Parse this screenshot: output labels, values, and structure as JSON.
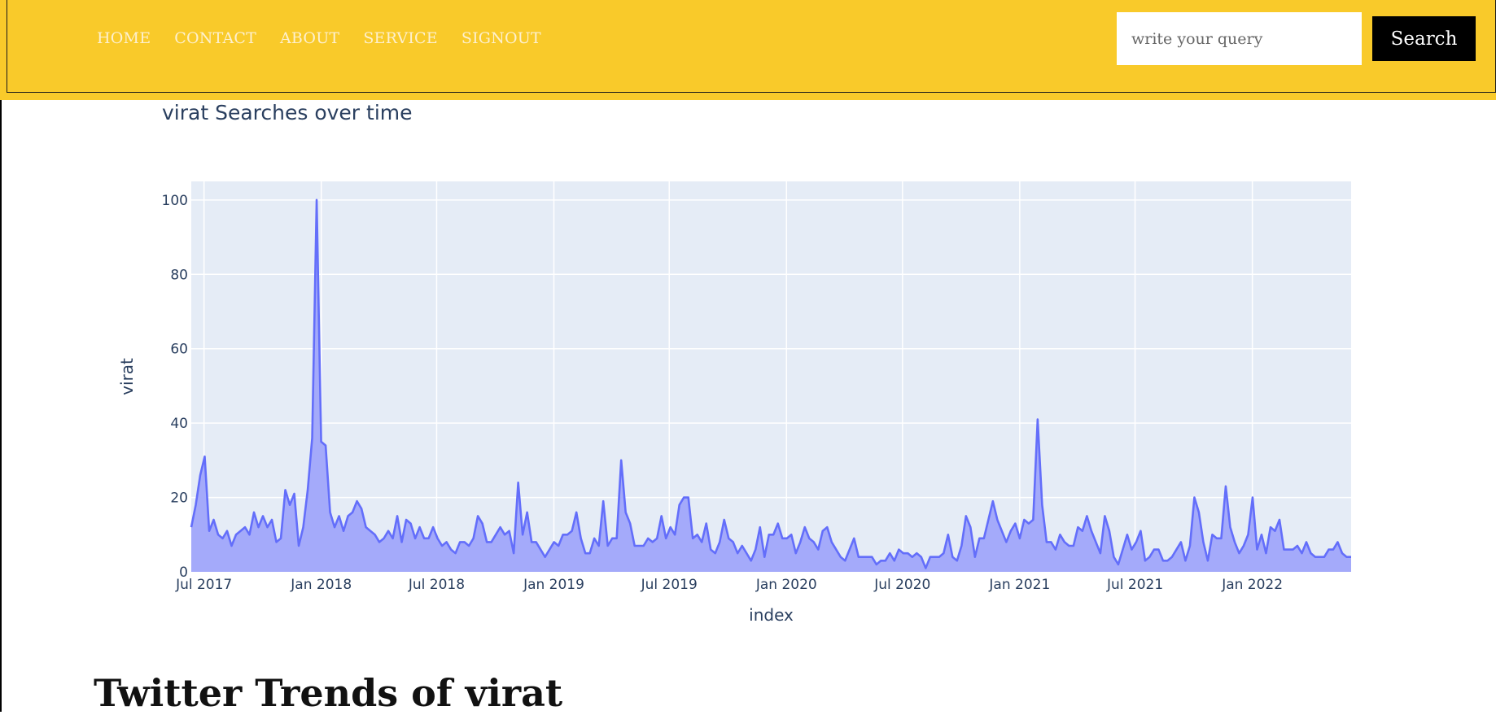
{
  "nav": {
    "links": [
      "HOME",
      "CONTACT",
      "ABOUT",
      "SERVICE",
      "SIGNOUT"
    ],
    "search_placeholder": "write your query",
    "search_button": "Search"
  },
  "colors": {
    "navbar": "#F9CA2A",
    "plot_bg": "#E5ECF6",
    "line": "#636EFA",
    "fill": "#A4AAFA"
  },
  "chart_title": "virat Searches over time",
  "chart_data": {
    "type": "area",
    "title": "virat Searches over time",
    "xlabel": "index",
    "ylabel": "virat",
    "x_start": "2017-06-11",
    "x_end": "2022-06-05",
    "x_ticks": [
      "Jul 2017",
      "Jan 2018",
      "Jul 2018",
      "Jan 2019",
      "Jul 2019",
      "Jan 2020",
      "Jul 2020",
      "Jan 2021",
      "Jul 2021",
      "Jan 2022"
    ],
    "y_ticks": [
      "0",
      "20",
      "40",
      "60",
      "80",
      "100"
    ],
    "ylim": [
      0,
      105
    ],
    "grid": true,
    "series": [
      {
        "name": "virat",
        "values": [
          12,
          18,
          26,
          31,
          11,
          14,
          10,
          9,
          11,
          7,
          10,
          11,
          12,
          10,
          16,
          12,
          15,
          12,
          14,
          8,
          9,
          22,
          18,
          21,
          7,
          12,
          22,
          36,
          100,
          35,
          34,
          16,
          12,
          15,
          11,
          15,
          16,
          19,
          17,
          12,
          11,
          10,
          8,
          9,
          11,
          9,
          15,
          8,
          14,
          13,
          9,
          12,
          9,
          9,
          12,
          9,
          7,
          8,
          6,
          5,
          8,
          8,
          7,
          9,
          15,
          13,
          8,
          8,
          10,
          12,
          10,
          11,
          5,
          24,
          10,
          16,
          8,
          8,
          6,
          4,
          6,
          8,
          7,
          10,
          10,
          11,
          16,
          9,
          5,
          5,
          9,
          7,
          19,
          7,
          9,
          9,
          30,
          16,
          13,
          7,
          7,
          7,
          9,
          8,
          9,
          15,
          9,
          12,
          10,
          18,
          20,
          20,
          9,
          10,
          8,
          13,
          6,
          5,
          8,
          14,
          9,
          8,
          5,
          7,
          5,
          3,
          6,
          12,
          4,
          10,
          10,
          13,
          9,
          9,
          10,
          5,
          8,
          12,
          9,
          8,
          6,
          11,
          12,
          8,
          6,
          4,
          3,
          6,
          9,
          4,
          4,
          4,
          4,
          2,
          3,
          3,
          5,
          3,
          6,
          5,
          5,
          4,
          5,
          4,
          1,
          4,
          4,
          4,
          5,
          10,
          4,
          3,
          7,
          15,
          12,
          4,
          9,
          9,
          14,
          19,
          14,
          11,
          8,
          11,
          13,
          9,
          14,
          13,
          14,
          41,
          18,
          8,
          8,
          6,
          10,
          8,
          7,
          7,
          12,
          11,
          15,
          11,
          8,
          5,
          15,
          11,
          4,
          2,
          6,
          10,
          6,
          8,
          11,
          3,
          4,
          6,
          6,
          3,
          3,
          4,
          6,
          8,
          3,
          7,
          20,
          16,
          8,
          3,
          10,
          9,
          9,
          23,
          12,
          8,
          5,
          7,
          10,
          20,
          6,
          10,
          5,
          12,
          11,
          14,
          6,
          6,
          6,
          7,
          5,
          8,
          5,
          4,
          4,
          4,
          6,
          6,
          8,
          5,
          4,
          4
        ]
      }
    ]
  },
  "section_heading": "Twitter Trends of virat"
}
